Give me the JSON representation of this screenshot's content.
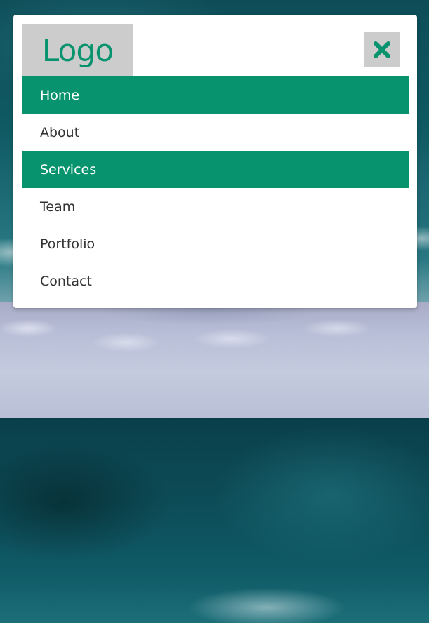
{
  "brand": {
    "logo_text": "Logo",
    "accent_color": "#07936e",
    "logo_bg_color": "#cccccc"
  },
  "close_button": {
    "icon": "close-icon"
  },
  "nav": {
    "items": [
      {
        "label": "Home",
        "highlighted": true
      },
      {
        "label": "About",
        "highlighted": false
      },
      {
        "label": "Services",
        "highlighted": true
      },
      {
        "label": "Team",
        "highlighted": false
      },
      {
        "label": "Portfolio",
        "highlighted": false
      },
      {
        "label": "Contact",
        "highlighted": false
      }
    ]
  }
}
